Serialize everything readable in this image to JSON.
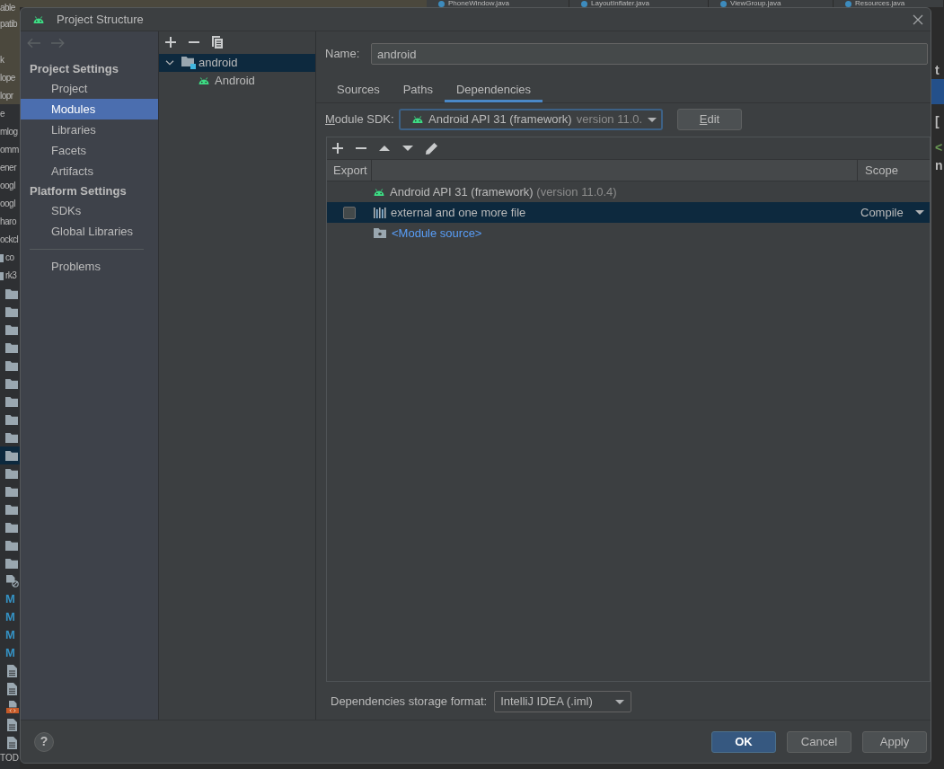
{
  "ide_background": {
    "editor_tabs": [
      {
        "label": "PhoneWindow.java"
      },
      {
        "label": "LayoutInflater.java"
      },
      {
        "label": "ViewGroup.java"
      },
      {
        "label": "Resources.java"
      }
    ],
    "project_tree": [
      {
        "kind": "text",
        "label": "able",
        "selected": false
      },
      {
        "kind": "text",
        "label": "patib",
        "selected": false
      },
      {
        "kind": "blank",
        "selected": false
      },
      {
        "kind": "text",
        "label": "k",
        "selected": false
      },
      {
        "kind": "text",
        "label": "lope",
        "selected": false
      },
      {
        "kind": "text",
        "label": "lopr",
        "selected": false
      },
      {
        "kind": "text",
        "label": "e",
        "selected": false
      },
      {
        "kind": "text",
        "label": "mlog",
        "selected": false
      },
      {
        "kind": "text",
        "label": "omm",
        "selected": false
      },
      {
        "kind": "text",
        "label": "ener",
        "selected": false
      },
      {
        "kind": "text",
        "label": "oogl",
        "selected": false
      },
      {
        "kind": "text",
        "label": "oogl",
        "selected": false
      },
      {
        "kind": "text",
        "label": "haro",
        "selected": false
      },
      {
        "kind": "text",
        "label": "ockcl",
        "selected": false
      },
      {
        "kind": "module",
        "label": "co",
        "selected": false
      },
      {
        "kind": "module",
        "label": "rk3",
        "selected": false
      },
      {
        "kind": "folder",
        "selected": false
      },
      {
        "kind": "folder",
        "selected": false
      },
      {
        "kind": "folder",
        "selected": false
      },
      {
        "kind": "folder",
        "selected": false
      },
      {
        "kind": "folder",
        "selected": false
      },
      {
        "kind": "folder",
        "selected": false
      },
      {
        "kind": "folder",
        "selected": false
      },
      {
        "kind": "folder",
        "selected": false
      },
      {
        "kind": "folder",
        "selected": false
      },
      {
        "kind": "folder",
        "selected": true
      },
      {
        "kind": "folder",
        "selected": false
      },
      {
        "kind": "folder",
        "selected": false
      },
      {
        "kind": "folder",
        "selected": false
      },
      {
        "kind": "folder",
        "selected": false
      },
      {
        "kind": "folder",
        "selected": false
      },
      {
        "kind": "folder",
        "selected": false
      },
      {
        "kind": "ignored_file",
        "selected": false
      },
      {
        "kind": "markdown",
        "icon": "M",
        "selected": false
      },
      {
        "kind": "markdown",
        "icon": "M",
        "selected": false
      },
      {
        "kind": "markdown",
        "icon": "M",
        "selected": false
      },
      {
        "kind": "markdown",
        "icon": "M",
        "selected": false
      },
      {
        "kind": "file",
        "selected": false
      },
      {
        "kind": "file",
        "selected": false
      },
      {
        "kind": "xml_file",
        "selected": false
      },
      {
        "kind": "file",
        "selected": false
      },
      {
        "kind": "file",
        "selected": false
      }
    ],
    "side_strip": [
      {
        "kind": "text",
        "label": "t",
        "color": "#bbbbbb"
      },
      {
        "kind": "highlight"
      },
      {
        "kind": "gap"
      },
      {
        "kind": "text",
        "label": "[",
        "color": "#bbbbbb"
      },
      {
        "kind": "gap"
      },
      {
        "kind": "text",
        "label": "<",
        "color": "#6a9955"
      },
      {
        "kind": "text",
        "label": "n",
        "color": "#bbbbbb"
      }
    ],
    "status_bar": {
      "label": "TOD"
    }
  },
  "window": {
    "title": "Project Structure"
  },
  "navigation": {
    "back": {
      "disabled": true
    },
    "forward": {
      "disabled": true
    }
  },
  "sidebar": {
    "items": [
      {
        "kind": "header",
        "label": "Project Settings"
      },
      {
        "kind": "item",
        "label": "Project",
        "selected": false
      },
      {
        "kind": "item",
        "label": "Modules",
        "selected": true
      },
      {
        "kind": "item",
        "label": "Libraries",
        "selected": false
      },
      {
        "kind": "item",
        "label": "Facets",
        "selected": false
      },
      {
        "kind": "item",
        "label": "Artifacts",
        "selected": false
      },
      {
        "kind": "header",
        "label": "Platform Settings"
      },
      {
        "kind": "item",
        "label": "SDKs",
        "selected": false
      },
      {
        "kind": "item",
        "label": "Global Libraries",
        "selected": false
      },
      {
        "kind": "separator"
      },
      {
        "kind": "item",
        "label": "Problems",
        "selected": false
      }
    ]
  },
  "modules": {
    "tree": [
      {
        "kind": "module",
        "label": "android",
        "expanded": true,
        "selected": true,
        "children": [
          {
            "kind": "android_facet",
            "label": "Android",
            "selected": false
          }
        ]
      }
    ]
  },
  "module_settings": {
    "name_label": "Name:",
    "name": "android",
    "tabs": [
      {
        "label": "Sources",
        "selected": false
      },
      {
        "label": "Paths",
        "selected": false
      },
      {
        "label": "Dependencies",
        "selected": true
      }
    ],
    "sdk": {
      "label": "Module SDK:",
      "value": "Android API 31 (framework)",
      "detail": "version 11.0."
    },
    "edit_button": "Edit"
  },
  "dependencies": {
    "columns": [
      {
        "label": "Export"
      },
      {
        "label": "Scope"
      }
    ],
    "rows": [
      {
        "kind": "sdk",
        "label": "Android API 31 (framework)",
        "detail": "(version 11.0.4)",
        "selected": false
      },
      {
        "kind": "library",
        "label": "external and one more file",
        "checked": false,
        "scope": "Compile",
        "selected": true
      },
      {
        "kind": "source",
        "label": "<Module source>",
        "selected": false
      }
    ]
  },
  "storage_format": {
    "label": "Dependencies storage format:",
    "value": "IntelliJ IDEA (.iml)"
  },
  "help_button": {
    "label": "?"
  },
  "buttons": [
    {
      "kind": "primary",
      "label": "OK"
    },
    {
      "kind": "default",
      "label": "Cancel"
    },
    {
      "kind": "default",
      "label": "Apply"
    }
  ]
}
